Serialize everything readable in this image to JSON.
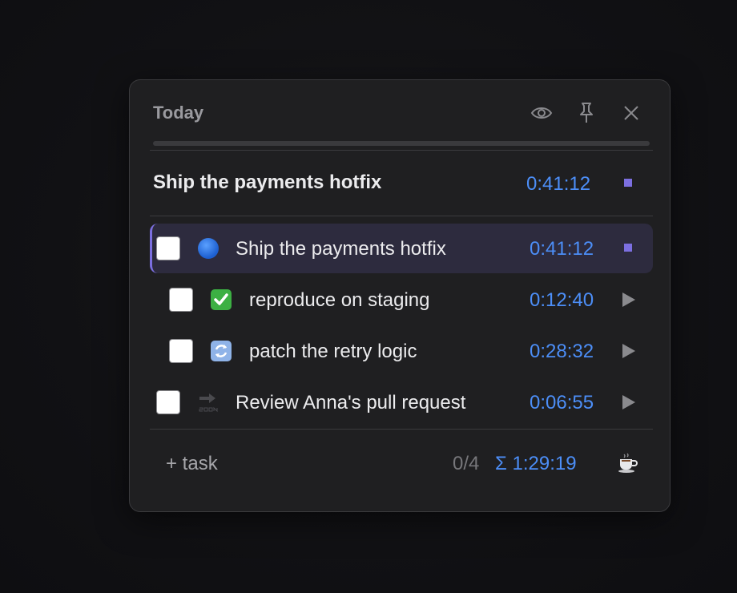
{
  "panel": {
    "title": "Today",
    "icons": [
      "eye-icon",
      "pin-icon",
      "close-icon"
    ],
    "progress_fraction": 0
  },
  "current": {
    "name": "Ship the payments hotfix",
    "time": "0:41:12"
  },
  "tasks": [
    {
      "name": "Ship the payments hotfix",
      "time": "0:41:12",
      "icon": "blue-circle-icon",
      "active": true,
      "indent": 0
    },
    {
      "name": "reproduce on staging",
      "time": "0:12:40",
      "icon": "check-mark-icon",
      "active": false,
      "indent": 1
    },
    {
      "name": "patch the retry logic",
      "time": "0:28:32",
      "icon": "refresh-icon",
      "active": false,
      "indent": 1
    },
    {
      "name": "Review Anna's pull request",
      "time": "0:06:55",
      "icon": "soon-arrow-icon",
      "active": false,
      "indent": 0
    }
  ],
  "footer": {
    "add_label": "+ task",
    "count": "0/4",
    "total": "Σ 1:29:19",
    "break_icon": "coffee-icon"
  },
  "colors": {
    "accent": "#7c6fe0",
    "time": "#4c8ef7",
    "panel_bg": "#1f1f21",
    "active_row_bg": "#2d2b3e"
  }
}
